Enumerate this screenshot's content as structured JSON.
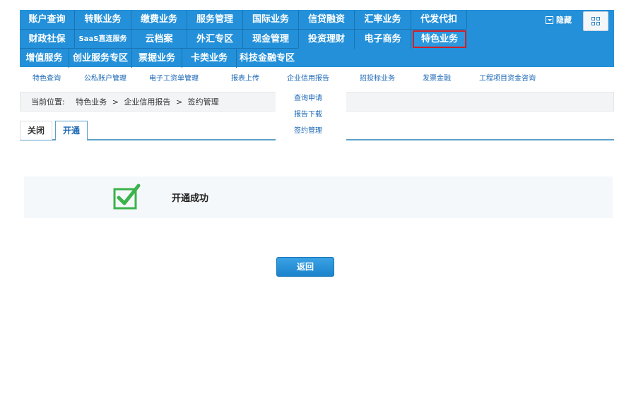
{
  "nav": {
    "row1": [
      "账户查询",
      "转账业务",
      "缴费业务",
      "服务管理",
      "国际业务",
      "信贷融资",
      "汇率业务",
      "代发代扣"
    ],
    "row2": [
      "财政社保",
      "SaaS直连服务",
      "云档案",
      "外汇专区",
      "现金管理",
      "投资理财",
      "电子商务",
      "特色业务"
    ],
    "row3": [
      "增值服务",
      "创业服务专区",
      "票据业务",
      "卡类业务",
      "科技金融专区"
    ],
    "hide_label": "隐藏",
    "active_item": "特色业务"
  },
  "subnav": [
    "特色查询",
    "公私账户管理",
    "电子工资单管理",
    "报表上传",
    "企业信用报告",
    "招投标业务",
    "发票金融",
    "工程项目资金咨询"
  ],
  "dropdown": [
    "查询申请",
    "报告下载",
    "签约管理"
  ],
  "breadcrumb": {
    "prefix": "当前位置:",
    "items": [
      "特色业务",
      "企业信用报告",
      "签约管理"
    ],
    "sep": ">"
  },
  "tabs": {
    "close": "关闭",
    "open": "开通"
  },
  "result": {
    "message": "开通成功",
    "icon": "checkbox-checked-icon"
  },
  "back_button": "返回",
  "colors": {
    "nav_bg": "#2390d9",
    "active_border": "#d0202a",
    "link": "#1a67b5",
    "success_green": "#3bb34a"
  }
}
